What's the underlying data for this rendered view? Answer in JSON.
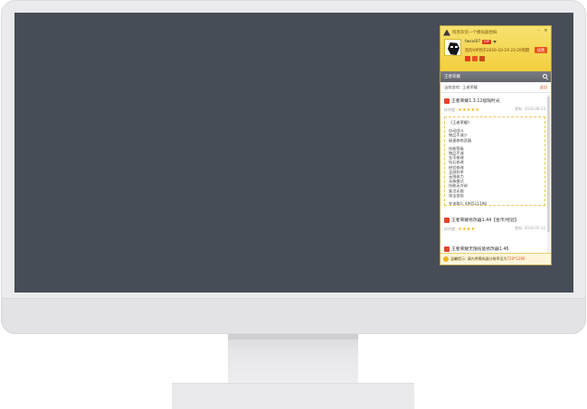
{
  "app": {
    "top_text": "暗黑杂货一个模拟器尝鲜",
    "user": {
      "name": "fwsxl07",
      "badge": "VIP",
      "vip_text": "您的VIP到于2016-10-19 23:29到期",
      "renew_label": "续费"
    },
    "search": {
      "placeholder": "王者荣耀"
    },
    "breadcrumb": {
      "prefix": "当前游戏:",
      "current": "王者荣耀",
      "back_label": "返回"
    },
    "cards": [
      {
        "title": "王者荣耀1.3.12极限时光",
        "score_label": "好评度:",
        "stars": "★★★★★",
        "updated": "更新: 2016-08-23",
        "lines": [
          "《王者荣耀》",
          "",
          "自动战斗",
          "物品不减少",
          "极速修炼武器",
          "",
          "技能等级",
          "物品不减",
          "金币修改",
          "钻石修改",
          "经验修改",
          "全屏秒杀",
          "无限体力",
          "无敌模式",
          "技能无冷却",
          "复活无限",
          "攻击加倍",
          "",
          "交流群1: 490511198",
          "微信公众号: 立即加入",
          "",
          "所在游戏: 王者荣耀"
        ]
      },
      {
        "title": "王者荣耀修改器1.44【金币/经验】",
        "score_label": "好评度:",
        "stars": "★★★★",
        "updated": "更新: 2016-07-12"
      },
      {
        "title": "王者荣耀无限技能修改器1.46"
      }
    ],
    "footer": {
      "text": "温馨提示: 请先将模拟器分辨率设为",
      "highlight": "720*1280"
    }
  }
}
